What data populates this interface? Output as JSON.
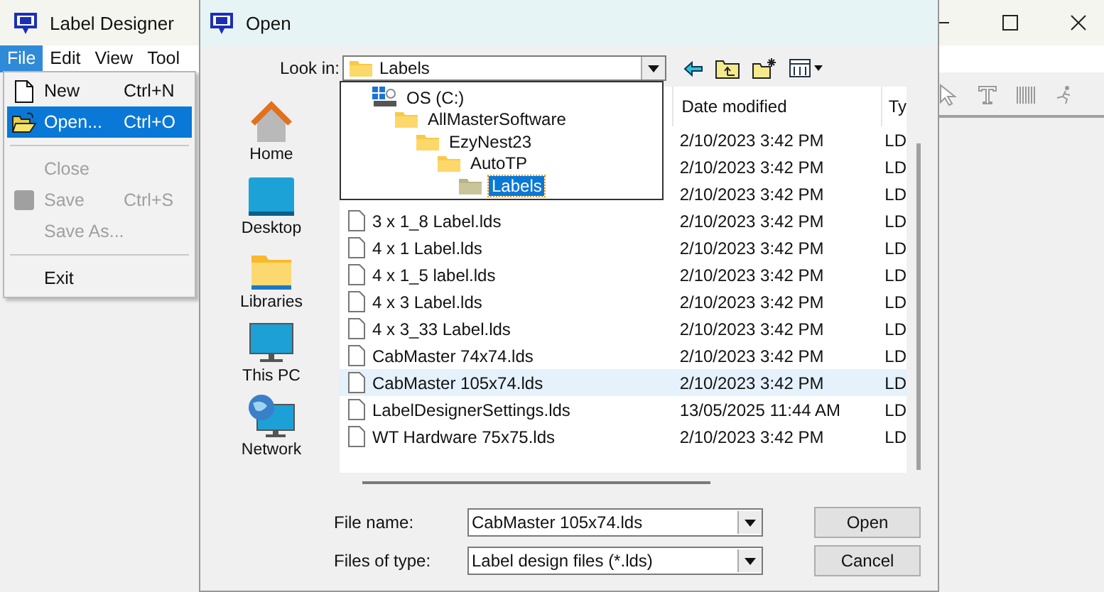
{
  "app_window": {
    "title": "Label Designer",
    "menu": [
      {
        "label": "File",
        "selected": true
      },
      {
        "label": "Edit",
        "selected": false
      },
      {
        "label": "View",
        "selected": false
      },
      {
        "label": "Tool",
        "selected": false
      }
    ]
  },
  "file_menu": {
    "items": [
      {
        "kind": "item",
        "label": "New",
        "shortcut": "Ctrl+N",
        "disabled": false,
        "selected": false
      },
      {
        "kind": "item",
        "label": "Open...",
        "shortcut": "Ctrl+O",
        "disabled": false,
        "selected": true
      },
      {
        "kind": "separator"
      },
      {
        "kind": "item",
        "label": "Close",
        "disabled": true,
        "selected": false
      },
      {
        "kind": "item",
        "label": "Save",
        "shortcut": "Ctrl+S",
        "disabled": true,
        "selected": false
      },
      {
        "kind": "item",
        "label": "Save As...",
        "disabled": true,
        "selected": false
      },
      {
        "kind": "separator"
      },
      {
        "kind": "item",
        "label": "Exit",
        "disabled": false,
        "selected": false
      }
    ]
  },
  "dialog": {
    "title": "Open",
    "look_in": {
      "label": "Look in:",
      "value": "Labels"
    },
    "folder_dropdown": [
      {
        "label": "OS (C:)",
        "selected": false,
        "children": [
          {
            "label": "AllMasterSoftware",
            "selected": false,
            "children": [
              {
                "label": "EzyNest23",
                "selected": false,
                "children": [
                  {
                    "label": "AutoTP",
                    "selected": false,
                    "children": [
                      {
                        "label": "Labels",
                        "selected": true
                      }
                    ]
                  }
                ]
              }
            ]
          }
        ]
      }
    ],
    "places": [
      {
        "label": "Home"
      },
      {
        "label": "Desktop"
      },
      {
        "label": "Libraries"
      },
      {
        "label": "This PC"
      },
      {
        "label": "Network"
      }
    ],
    "file_list": {
      "columns": [
        "Date modified",
        "Ty"
      ],
      "rows": [
        {
          "date": "2/10/2023 3:42 PM",
          "type": "LD",
          "selected": false
        },
        {
          "date": "2/10/2023 3:42 PM",
          "type": "LD",
          "selected": false
        },
        {
          "date": "2/10/2023 3:42 PM",
          "type": "LD",
          "selected": false
        },
        {
          "name": "3 x 1_8 Label.lds",
          "date": "2/10/2023 3:42 PM",
          "type": "LD",
          "selected": false
        },
        {
          "name": "4 x 1 Label.lds",
          "date": "2/10/2023 3:42 PM",
          "type": "LD",
          "selected": false
        },
        {
          "name": "4 x 1_5 label.lds",
          "date": "2/10/2023 3:42 PM",
          "type": "LD",
          "selected": false
        },
        {
          "name": "4 x 3 Label.lds",
          "date": "2/10/2023 3:42 PM",
          "type": "LD",
          "selected": false
        },
        {
          "name": "4 x 3_33 Label.lds",
          "date": "2/10/2023 3:42 PM",
          "type": "LD",
          "selected": false
        },
        {
          "name": "CabMaster 74x74.lds",
          "date": "2/10/2023 3:42 PM",
          "type": "LD",
          "selected": false
        },
        {
          "name": "CabMaster 105x74.lds",
          "date": "2/10/2023 3:42 PM",
          "type": "LD",
          "selected": true
        },
        {
          "name": "LabelDesignerSettings.lds",
          "date": "13/05/2025 11:44 AM",
          "type": "LD",
          "selected": false
        },
        {
          "name": "WT Hardware 75x75.lds",
          "date": "2/10/2023 3:42 PM",
          "type": "LD",
          "selected": false
        }
      ]
    },
    "file_name": {
      "label": "File name:",
      "value": "CabMaster 105x74.lds"
    },
    "file_type": {
      "label": "Files of type:",
      "value": "Label design files (*.lds)"
    },
    "buttons": [
      "Open",
      "Cancel"
    ]
  }
}
